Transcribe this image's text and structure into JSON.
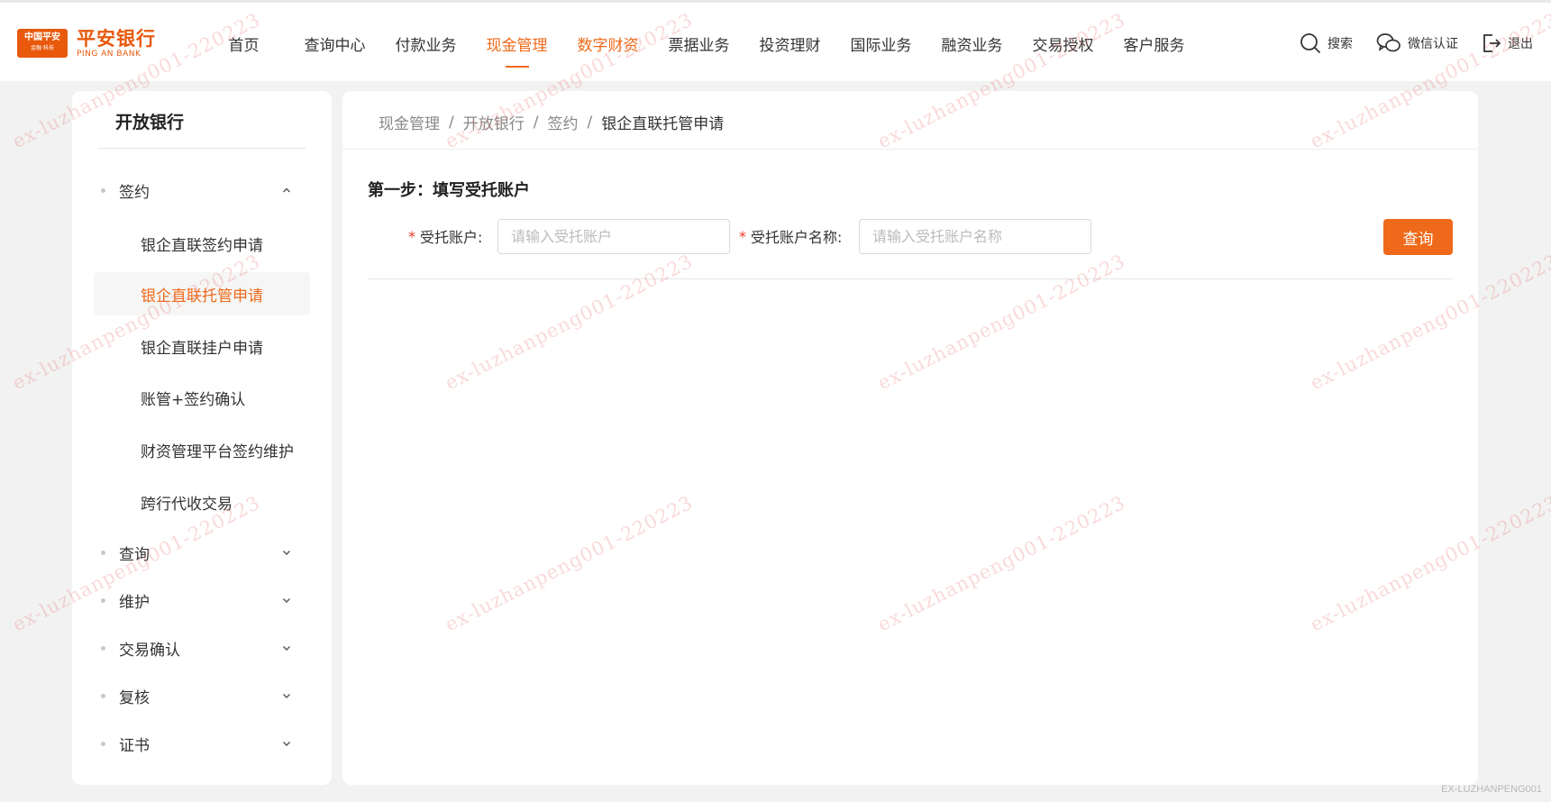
{
  "logo": {
    "badge_text": "中国平安",
    "badge_sub": "金融·科技",
    "name_cn": "平安银行",
    "name_en": "PING AN BANK"
  },
  "nav": {
    "items": [
      {
        "label": "首页"
      },
      {
        "label": "查询中心"
      },
      {
        "label": "付款业务"
      },
      {
        "label": "现金管理"
      },
      {
        "label": "数字财资"
      },
      {
        "label": "票据业务"
      },
      {
        "label": "投资理财"
      },
      {
        "label": "国际业务"
      },
      {
        "label": "融资业务"
      },
      {
        "label": "交易授权"
      },
      {
        "label": "客户服务"
      }
    ],
    "active_index": 3,
    "accent_color": "#ee6a1a"
  },
  "tools": {
    "search": "搜索",
    "wechat": "微信认证",
    "logout": "退出"
  },
  "sidebar": {
    "title": "开放银行",
    "groups": [
      {
        "label": "签约",
        "expanded": true
      },
      {
        "label": "查询",
        "expanded": false
      },
      {
        "label": "维护",
        "expanded": false
      },
      {
        "label": "交易确认",
        "expanded": false
      },
      {
        "label": "复核",
        "expanded": false
      },
      {
        "label": "证书",
        "expanded": false
      }
    ],
    "sub_items": [
      {
        "label": "银企直联签约申请"
      },
      {
        "label": "银企直联托管申请"
      },
      {
        "label": "银企直联挂户申请"
      },
      {
        "label": "账管+签约确认"
      },
      {
        "label": "财资管理平台签约维护"
      },
      {
        "label": "跨行代收交易"
      }
    ],
    "active_sub_index": 1
  },
  "breadcrumb": {
    "items": [
      "现金管理",
      "开放银行",
      "签约"
    ],
    "current": "银企直联托管申请",
    "separator": "/"
  },
  "form": {
    "step_title": "第一步：填写受托账户",
    "required_mark": "*",
    "account_label": "受托账户:",
    "account_placeholder": "请输入受托账户",
    "account_value": "",
    "account_name_label": "受托账户名称:",
    "account_name_placeholder": "请输入受托账户名称",
    "account_name_value": "",
    "query_button": "查询"
  },
  "watermark": {
    "text": "ex-luzhanpeng001-220223",
    "footer": "EX-LUZHANPENG001"
  }
}
